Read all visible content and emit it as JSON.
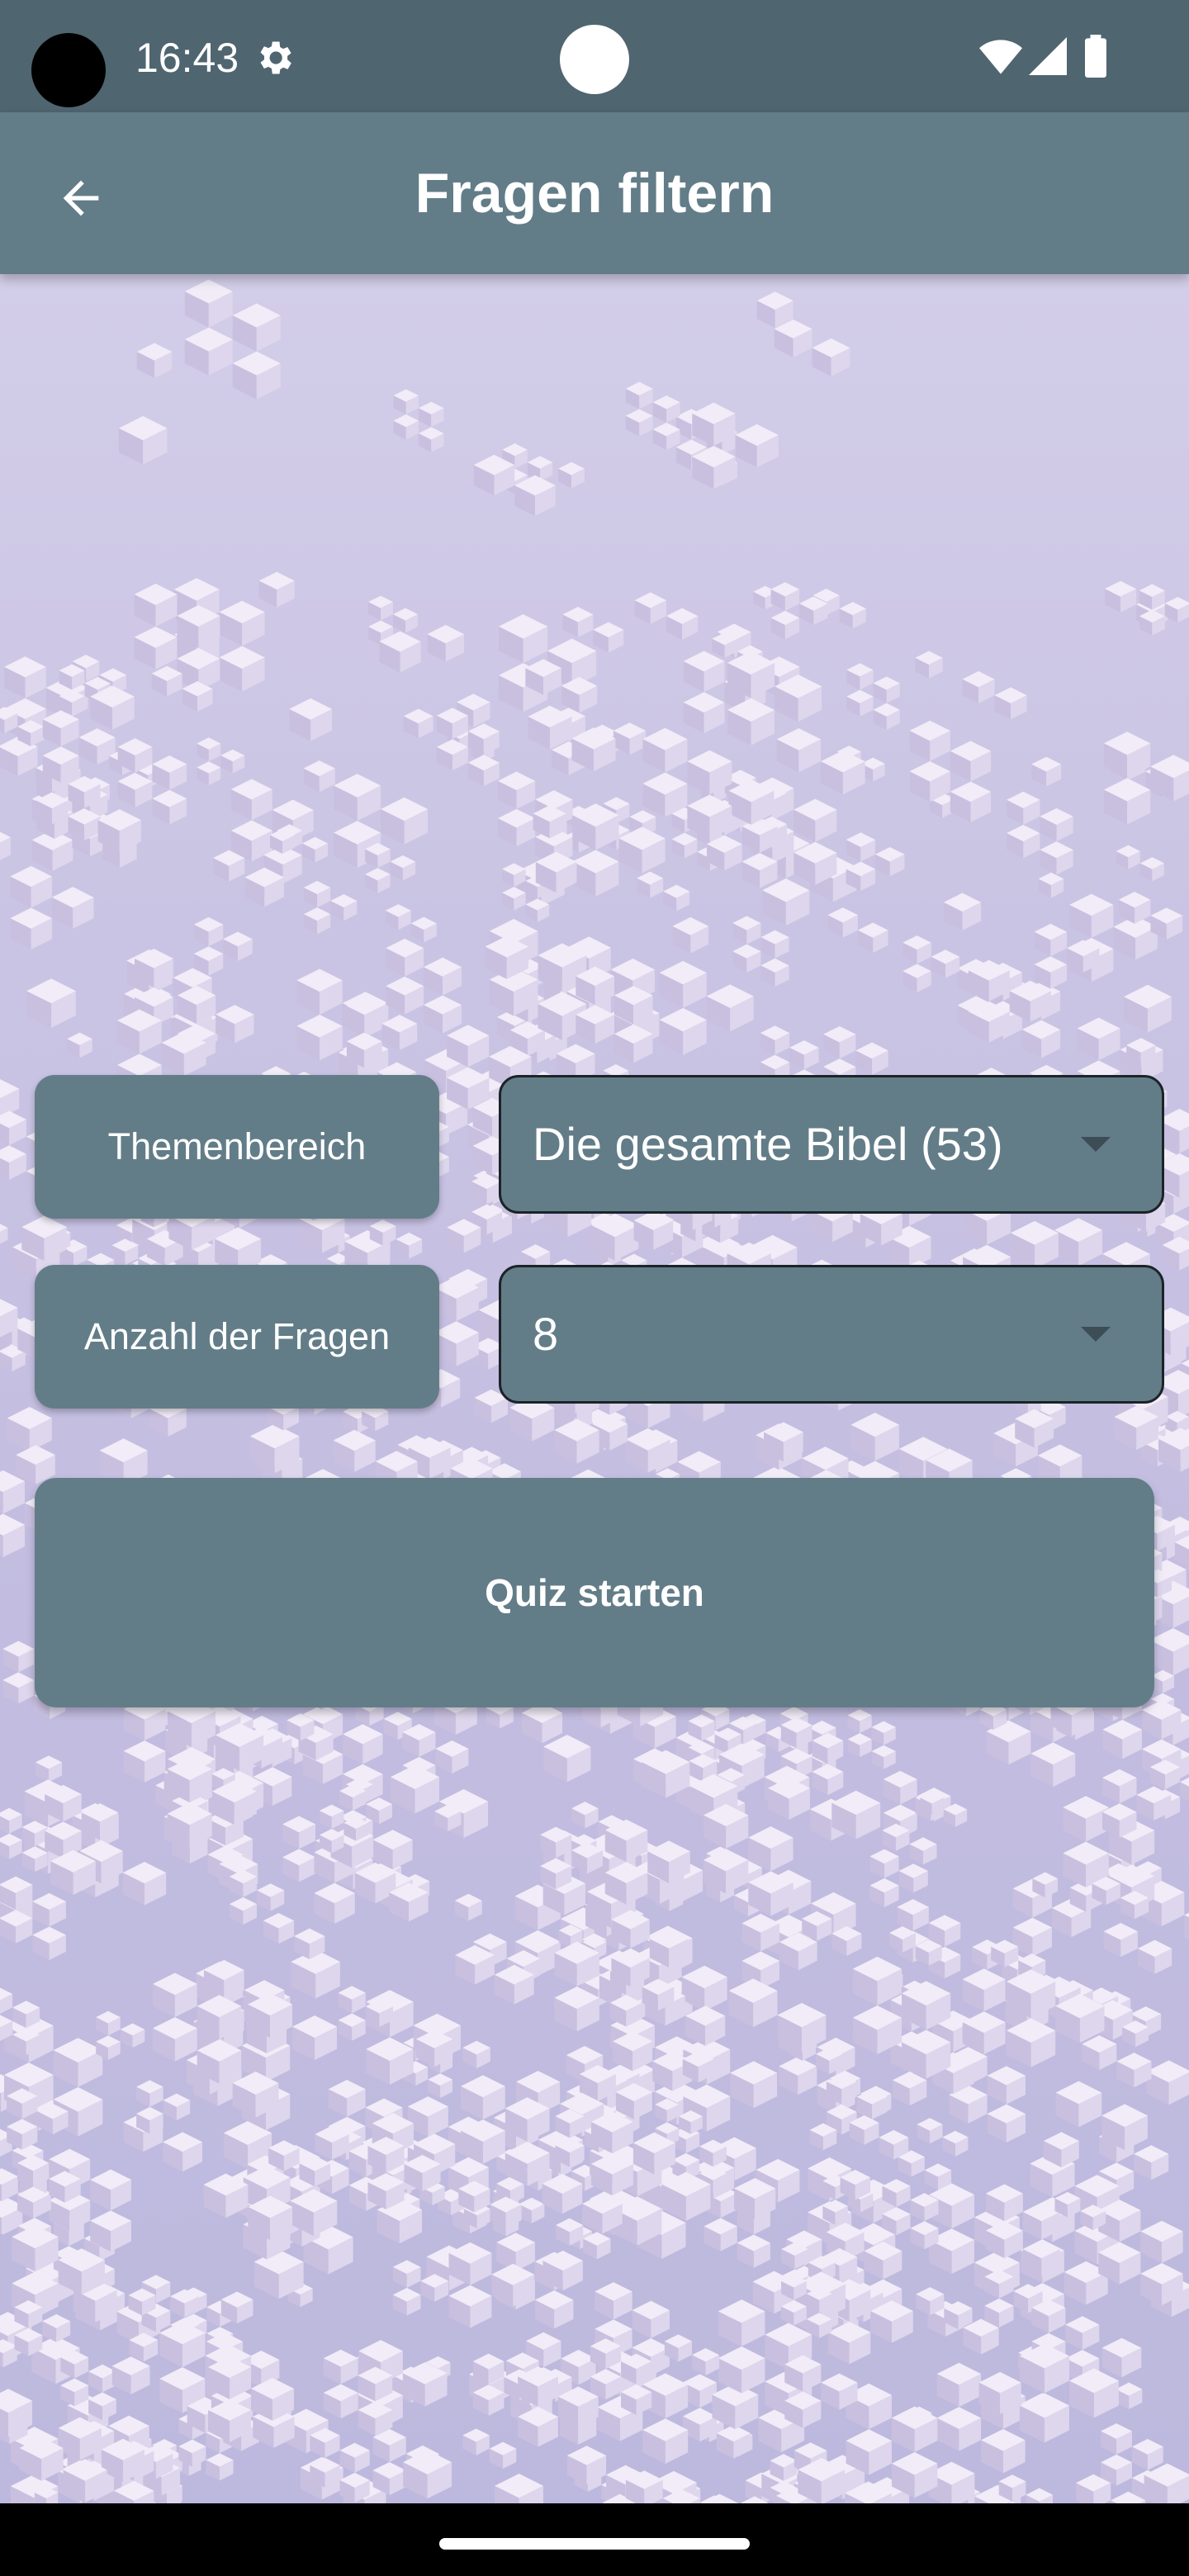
{
  "status_bar": {
    "time": "16:43",
    "icons": [
      "settings-icon",
      "wifi-icon",
      "signal-icon",
      "battery-icon"
    ]
  },
  "app_bar": {
    "title": "Fragen filtern",
    "back_icon": "arrow-left-icon"
  },
  "form": {
    "topic_label": "Themenbereich",
    "topic_value": "Die gesamte Bibel (53)",
    "count_label": "Anzahl der Fragen",
    "count_value": "8",
    "start_button_label": "Quiz starten"
  },
  "colors": {
    "status_bar": "#4f6570",
    "app_bar": "#627d88",
    "control_background": "#627d88",
    "dropdown_border": "#1c2328",
    "background": "#cac4e4"
  }
}
